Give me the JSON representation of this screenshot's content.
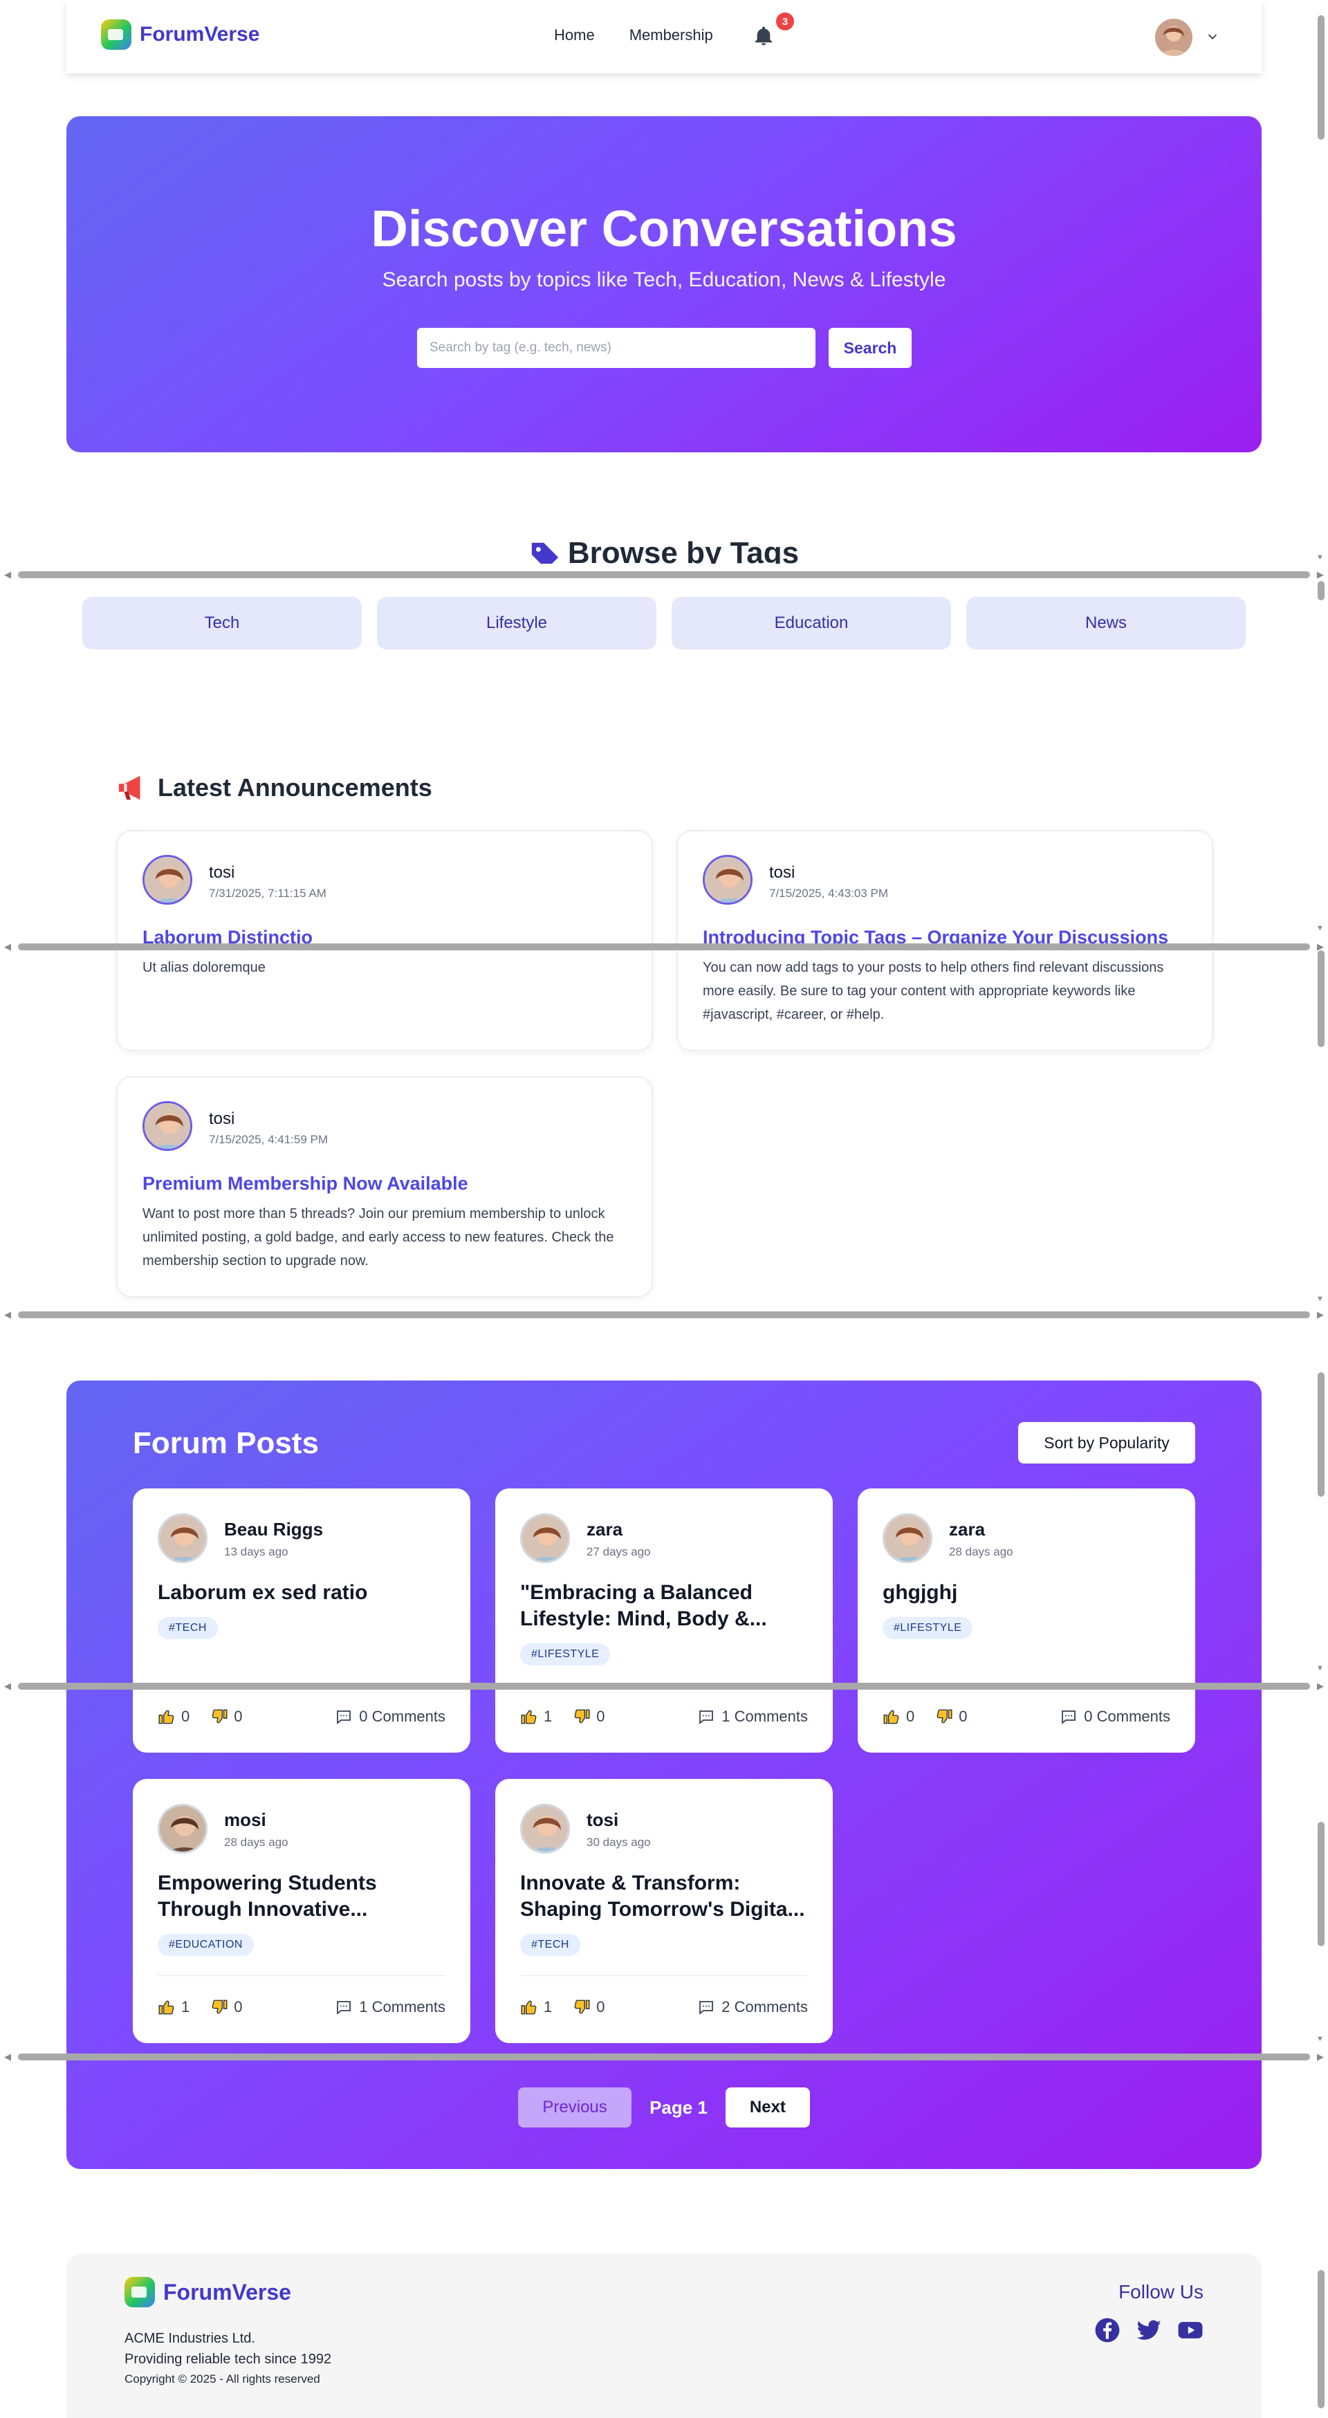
{
  "navbar": {
    "brand": "ForumVerse",
    "links": [
      "Home",
      "Membership"
    ],
    "notification_count": "3"
  },
  "hero": {
    "title": "Discover Conversations",
    "subtitle": "Search posts by topics like Tech, Education, News & Lifestyle",
    "search_placeholder": "Search by tag (e.g. tech, news)",
    "search_button": "Search"
  },
  "tags": {
    "title": "Browse by Tags",
    "items": [
      "Tech",
      "Lifestyle",
      "Education",
      "News"
    ]
  },
  "announcements": {
    "title": "Latest Announcements",
    "items": [
      {
        "author": "tosi",
        "date": "7/31/2025, 7:11:15 AM",
        "title": "Laborum Distinctio",
        "body": "Ut alias doloremque"
      },
      {
        "author": "tosi",
        "date": "7/15/2025, 4:43:03 PM",
        "title": "Introducing Topic Tags – Organize Your Discussions",
        "body": "You can now add tags to your posts to help others find relevant discussions more easily. Be sure to tag your content with appropriate keywords like #javascript, #career, or #help."
      },
      {
        "author": "tosi",
        "date": "7/15/2025, 4:41:59 PM",
        "title": "Premium Membership Now Available",
        "body": "Want to post more than 5 threads? Join our premium membership to unlock unlimited posting, a gold badge, and early access to new features. Check the membership section to upgrade now."
      }
    ]
  },
  "forum": {
    "title": "Forum Posts",
    "sort_button": "Sort by Popularity",
    "posts": [
      {
        "author": "Beau Riggs",
        "time": "13 days ago",
        "title": "Laborum ex sed ratio",
        "tag": "#TECH",
        "likes": "0",
        "dislikes": "0",
        "comments": "0 Comments"
      },
      {
        "author": "zara",
        "time": "27 days ago",
        "title": "\"Embracing a Balanced Lifestyle: Mind, Body &...",
        "tag": "#LIFESTYLE",
        "likes": "1",
        "dislikes": "0",
        "comments": "1 Comments"
      },
      {
        "author": "zara",
        "time": "28 days ago",
        "title": "ghgjghj",
        "tag": "#LIFESTYLE",
        "likes": "0",
        "dislikes": "0",
        "comments": "0 Comments"
      },
      {
        "author": "mosi",
        "time": "28 days ago",
        "title": "Empowering Students Through Innovative...",
        "tag": "#EDUCATION",
        "likes": "1",
        "dislikes": "0",
        "comments": "1 Comments"
      },
      {
        "author": "tosi",
        "time": "30 days ago",
        "title": "Innovate & Transform: Shaping Tomorrow's Digita...",
        "tag": "#TECH",
        "likes": "1",
        "dislikes": "0",
        "comments": "2 Comments"
      }
    ],
    "pager": {
      "previous": "Previous",
      "page": "Page 1",
      "next": "Next"
    }
  },
  "footer": {
    "brand": "ForumVerse",
    "company": "ACME Industries Ltd.",
    "tagline": "Providing reliable tech since 1992",
    "copyright": "Copyright © 2025 - All rights reserved",
    "follow": "Follow Us",
    "socials": [
      "facebook-icon",
      "twitter-icon",
      "youtube-icon"
    ]
  },
  "colors": {
    "brand": "#4338ca",
    "accent": "#7c4dff",
    "badge": "#ef4444"
  }
}
